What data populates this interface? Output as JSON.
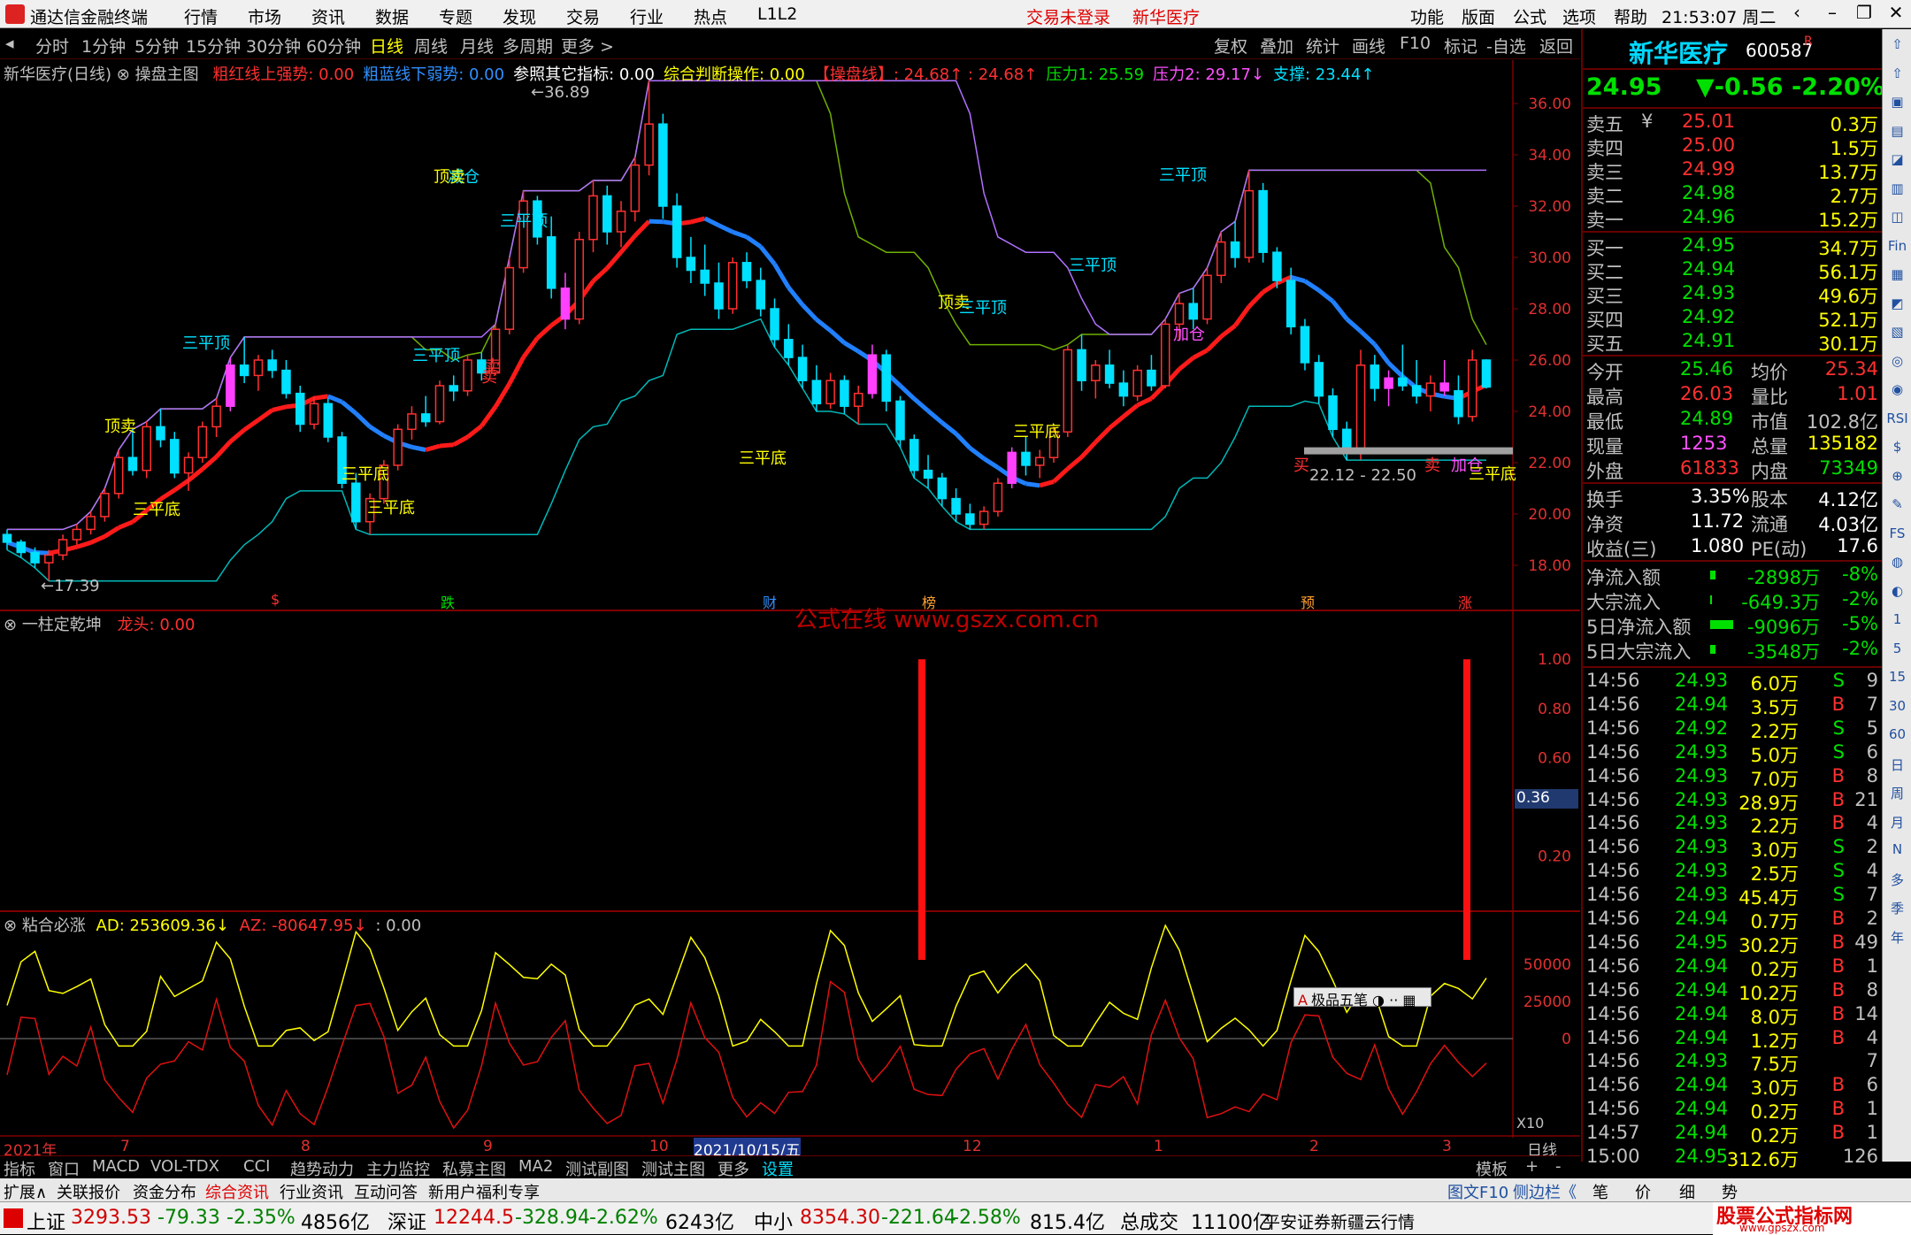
{
  "app": {
    "title": "通达信金融终端",
    "menu": [
      "行情",
      "市场",
      "资讯",
      "数据",
      "专题",
      "发现",
      "交易",
      "行业",
      "热点",
      "L1L2"
    ],
    "alert_login": "交易未登录",
    "alert_stock": "新华医疗",
    "right_menu": [
      "功能",
      "版面",
      "公式",
      "选项",
      "帮助"
    ],
    "clock": "21:53:07 周二"
  },
  "toolbar": {
    "periods": [
      "分时",
      "1分钟",
      "5分钟",
      "15分钟",
      "30分钟",
      "60分钟",
      "日线",
      "周线",
      "月线",
      "多周期",
      "更多 >"
    ],
    "selected": "日线",
    "right_items": [
      "复权",
      "叠加",
      "统计",
      "画线",
      "F10",
      "标记",
      "-自选",
      "返回"
    ]
  },
  "main_panel": {
    "stock_label": "新华医疗(日线)",
    "indicator_name": "操盘主图",
    "params": [
      {
        "label": "粗红线上强势: 0.00",
        "color": "#ff3030"
      },
      {
        "label": "粗蓝线下弱势: 0.00",
        "color": "#3090ff"
      },
      {
        "label": "参照其它指标: 0.00",
        "color": "#ffffff"
      },
      {
        "label": "综合判断操作: 0.00",
        "color": "#ffff00"
      },
      {
        "label": "【操盘线】: 24.68↑ : 24.68↑",
        "color": "#ff3030"
      },
      {
        "label": "压力1: 25.59",
        "color": "#00e000"
      },
      {
        "label": "压力2: 29.17↓",
        "color": "#ff50ff"
      },
      {
        "label": "支撑: 23.44↑",
        "color": "#00e0ff"
      }
    ],
    "y_ticks": [
      "36.00",
      "34.00",
      "32.00",
      "30.00",
      "28.00",
      "26.00",
      "24.00",
      "22.00",
      "20.00",
      "18.00"
    ],
    "high_label": "36.89",
    "low_label": "17.39",
    "range_label": "22.12 - 22.50",
    "annotations": [
      "顶卖",
      "三平顶",
      "减仓",
      "卖",
      "三平底",
      "顶卖",
      "三平顶",
      "卖",
      "三平底",
      "三平底",
      "三平顶",
      "顶卖",
      "三平顶",
      "三平底",
      "三平底",
      "三平顶",
      "三平顶",
      "加仓",
      "加仓",
      "三平底",
      "买",
      "卖"
    ],
    "event_markers": [
      "$",
      "跌",
      "财",
      "榜",
      "预",
      "涨"
    ],
    "watermark": "公式在线  www.gszx.com.cn"
  },
  "mid_panel": {
    "name": "一柱定乾坤",
    "param": "龙头: 0.00",
    "y_ticks": [
      "1.00",
      "0.80",
      "0.60",
      "0.36",
      "0.20"
    ],
    "current_value": "0.36"
  },
  "low_panel": {
    "name": "粘合必涨",
    "ad": "AD: 253609.36↓",
    "az": "AZ: -80647.95↓",
    "extra": ": 0.00",
    "y_ticks": [
      "50000",
      "25000",
      "0"
    ],
    "scale_label": "X10",
    "ime_label": "极品五笔"
  },
  "x_axis": {
    "labels": [
      "2021年",
      "7",
      "8",
      "9",
      "10",
      "2021/10/15/五",
      "12",
      "1",
      "2",
      "3"
    ],
    "period": "日线"
  },
  "quote": {
    "name": "新华医疗",
    "code": "600587",
    "flag": "R",
    "price": "24.95",
    "change": "▼-0.56",
    "pct": "-2.20%",
    "asks": [
      {
        "label": "卖五",
        "sym": "¥",
        "price": "25.01",
        "vol": "0.3万"
      },
      {
        "label": "卖四",
        "sym": "",
        "price": "25.00",
        "vol": "1.5万"
      },
      {
        "label": "卖三",
        "sym": "",
        "price": "24.99",
        "vol": "13.7万"
      },
      {
        "label": "卖二",
        "sym": "",
        "price": "24.98",
        "vol": "2.7万"
      },
      {
        "label": "卖一",
        "sym": "",
        "price": "24.96",
        "vol": "15.2万"
      }
    ],
    "bids": [
      {
        "label": "买一",
        "price": "24.95",
        "vol": "34.7万"
      },
      {
        "label": "买二",
        "price": "24.94",
        "vol": "56.1万"
      },
      {
        "label": "买三",
        "price": "24.93",
        "vol": "49.6万"
      },
      {
        "label": "买四",
        "price": "24.92",
        "vol": "52.1万"
      },
      {
        "label": "买五",
        "price": "24.91",
        "vol": "30.1万"
      }
    ],
    "stats": [
      [
        "今开",
        "25.46",
        "均价",
        "25.34"
      ],
      [
        "最高",
        "26.03",
        "量比",
        "1.01"
      ],
      [
        "最低",
        "24.89",
        "市值",
        "102.8亿"
      ],
      [
        "现量",
        "1253",
        "总量",
        "135182"
      ],
      [
        "外盘",
        "61833",
        "内盘",
        "73349"
      ]
    ],
    "stats2": [
      [
        "换手",
        "3.35%",
        "股本",
        "4.12亿"
      ],
      [
        "净资",
        "11.72",
        "流通",
        "4.03亿"
      ],
      [
        "收益(三)",
        "1.080",
        "PE(动)",
        "17.6"
      ]
    ],
    "flows": [
      {
        "label": "净流入额",
        "value": "-2898万",
        "pct": "-8%"
      },
      {
        "label": "大宗流入",
        "value": "-649.3万",
        "pct": "-2%"
      },
      {
        "label": "5日净流入额",
        "value": "-9096万",
        "pct": "-5%"
      },
      {
        "label": "5日大宗流入",
        "value": "-3548万",
        "pct": "-2%"
      }
    ],
    "ticks": [
      [
        "14:56",
        "24.93",
        "6.0万",
        "S",
        "9"
      ],
      [
        "14:56",
        "24.94",
        "3.5万",
        "B",
        "7"
      ],
      [
        "14:56",
        "24.92",
        "2.2万",
        "S",
        "5"
      ],
      [
        "14:56",
        "24.93",
        "5.0万",
        "S",
        "6"
      ],
      [
        "14:56",
        "24.93",
        "7.0万",
        "B",
        "8"
      ],
      [
        "14:56",
        "24.93",
        "28.9万",
        "B",
        "21"
      ],
      [
        "14:56",
        "24.93",
        "2.2万",
        "B",
        "4"
      ],
      [
        "14:56",
        "24.93",
        "3.0万",
        "S",
        "2"
      ],
      [
        "14:56",
        "24.93",
        "2.5万",
        "S",
        "4"
      ],
      [
        "14:56",
        "24.93",
        "45.4万",
        "S",
        "7"
      ],
      [
        "14:56",
        "24.94",
        "0.7万",
        "B",
        "2"
      ],
      [
        "14:56",
        "24.95",
        "30.2万",
        "B",
        "49"
      ],
      [
        "14:56",
        "24.94",
        "0.2万",
        "B",
        "1"
      ],
      [
        "14:56",
        "24.94",
        "10.2万",
        "B",
        "8"
      ],
      [
        "14:56",
        "24.94",
        "8.0万",
        "B",
        "14"
      ],
      [
        "14:56",
        "24.94",
        "1.2万",
        "B",
        "4"
      ],
      [
        "14:56",
        "24.93",
        "7.5万",
        "",
        "7"
      ],
      [
        "14:56",
        "24.94",
        "3.0万",
        "B",
        "6"
      ],
      [
        "14:56",
        "24.94",
        "0.2万",
        "B",
        "1"
      ],
      [
        "14:57",
        "24.94",
        "0.2万",
        "B",
        "1"
      ],
      [
        "15:00",
        "24.95",
        "312.6万",
        "",
        "126"
      ]
    ]
  },
  "sidebar_items": [
    "⇧",
    "⇧",
    "▣",
    "▤",
    "◪",
    "▥",
    "◫",
    "Fin",
    "▦",
    "◩",
    "▧",
    "◎",
    "◉",
    "RSI",
    "$",
    "⊕",
    "✎",
    "FS",
    "◍",
    "◐",
    "1",
    "5",
    "15",
    "30",
    "60",
    "日",
    "周",
    "月",
    "N",
    "多",
    "季",
    "年"
  ],
  "bottom_tabs": [
    "指标",
    "窗口",
    "MACD",
    "VOL-TDX",
    "CCI",
    "趋势动力",
    "主力监控",
    "私募主图",
    "MA2",
    "测试副图",
    "测试主图",
    "更多",
    "设置"
  ],
  "bottom_right": [
    "模板",
    "+",
    "-"
  ],
  "bottom_tabs2": [
    "扩展∧",
    "关联报价",
    "资金分布",
    "综合资讯",
    "行业资讯",
    "互动问答",
    "新用户福利专享"
  ],
  "bottom_tabs2_right": [
    "图文F10",
    "侧边栏《",
    "笔",
    "价",
    "细",
    "势"
  ],
  "status": {
    "sh_label": "上证",
    "sh_val": "3293.53",
    "sh_chg": "-79.33",
    "sh_pct": "-2.35%",
    "sh_amt": "4856亿",
    "sz_label": "深证",
    "sz_val": "12244.5",
    "sz_chg": "-328.94",
    "sz_pct": "-2.62%",
    "sz_amt": "6243亿",
    "zx_label": "中小",
    "zx_val": "8354.30",
    "zx_chg": "-221.64",
    "zx_pct": "-2.58%",
    "zx_amt": "815.4亿",
    "total_label": "总成交",
    "total_val": "11100亿",
    "broker": "平安证券新疆云行情",
    "logo_top": "股票公式指标网",
    "logo_bottom": "www.gpszx.com"
  },
  "chart_data": {
    "type": "candlestick",
    "price_range": [
      17,
      37
    ],
    "ohlc_approx": [
      [
        19.2,
        19.4,
        18.6,
        18.9
      ],
      [
        18.9,
        19.0,
        18.3,
        18.5
      ],
      [
        18.5,
        18.7,
        17.9,
        18.1
      ],
      [
        18.1,
        18.6,
        17.39,
        18.4
      ],
      [
        18.4,
        19.2,
        18.2,
        19.0
      ],
      [
        19.0,
        19.6,
        18.8,
        19.4
      ],
      [
        19.4,
        20.1,
        19.2,
        19.9
      ],
      [
        19.9,
        21.0,
        19.7,
        20.8
      ],
      [
        20.8,
        22.5,
        20.6,
        22.2
      ],
      [
        22.2,
        23.3,
        21.5,
        21.7
      ],
      [
        21.7,
        23.6,
        21.4,
        23.4
      ],
      [
        23.4,
        24.1,
        22.6,
        22.9
      ],
      [
        22.9,
        23.2,
        21.4,
        21.6
      ],
      [
        21.6,
        22.4,
        20.9,
        22.2
      ],
      [
        22.2,
        23.6,
        22.0,
        23.4
      ],
      [
        23.4,
        24.5,
        23.0,
        24.2
      ],
      [
        24.2,
        26.1,
        24.0,
        25.8
      ],
      [
        25.8,
        26.9,
        25.1,
        25.4
      ],
      [
        25.4,
        26.2,
        24.8,
        26.0
      ],
      [
        26.0,
        26.4,
        25.3,
        25.6
      ],
      [
        25.6,
        26.0,
        24.5,
        24.7
      ],
      [
        24.7,
        25.0,
        23.2,
        23.5
      ],
      [
        23.5,
        24.6,
        23.3,
        24.3
      ],
      [
        24.3,
        24.5,
        22.8,
        23.0
      ],
      [
        23.0,
        23.2,
        21.0,
        21.2
      ],
      [
        21.2,
        21.6,
        19.4,
        19.7
      ],
      [
        19.7,
        20.8,
        19.2,
        20.6
      ],
      [
        20.6,
        22.1,
        20.4,
        21.9
      ],
      [
        21.9,
        23.5,
        21.7,
        23.3
      ],
      [
        23.3,
        24.2,
        22.9,
        23.9
      ],
      [
        23.9,
        24.6,
        23.4,
        23.6
      ],
      [
        23.6,
        25.2,
        23.5,
        25.0
      ],
      [
        25.0,
        25.4,
        24.4,
        24.8
      ],
      [
        24.8,
        26.2,
        24.6,
        26.0
      ],
      [
        26.0,
        26.3,
        25.2,
        25.5
      ],
      [
        25.5,
        27.4,
        25.4,
        27.2
      ],
      [
        27.2,
        30.0,
        27.0,
        29.6
      ],
      [
        29.6,
        32.6,
        29.4,
        32.2
      ],
      [
        32.2,
        32.4,
        30.5,
        30.8
      ],
      [
        30.8,
        31.6,
        28.4,
        28.8
      ],
      [
        28.8,
        29.4,
        27.2,
        27.6
      ],
      [
        27.6,
        31.0,
        27.4,
        30.7
      ],
      [
        30.7,
        33.0,
        30.2,
        32.4
      ],
      [
        32.4,
        32.8,
        30.5,
        31.0
      ],
      [
        31.0,
        32.2,
        30.4,
        31.8
      ],
      [
        31.8,
        33.9,
        31.4,
        33.6
      ],
      [
        33.6,
        36.89,
        33.2,
        35.2
      ],
      [
        35.2,
        35.6,
        31.5,
        32.0
      ],
      [
        32.0,
        32.5,
        29.6,
        30.0
      ],
      [
        30.0,
        30.8,
        29.0,
        29.5
      ],
      [
        29.5,
        30.5,
        28.5,
        29.0
      ],
      [
        29.0,
        29.8,
        27.6,
        28.0
      ],
      [
        28.0,
        30.0,
        27.8,
        29.8
      ],
      [
        29.8,
        30.2,
        28.8,
        29.1
      ],
      [
        29.1,
        29.6,
        27.7,
        28.0
      ],
      [
        28.0,
        28.4,
        26.5,
        26.8
      ],
      [
        26.8,
        27.4,
        25.8,
        26.1
      ],
      [
        26.1,
        26.6,
        24.9,
        25.2
      ],
      [
        25.2,
        25.8,
        24.0,
        24.3
      ],
      [
        24.3,
        25.5,
        24.1,
        25.2
      ],
      [
        25.2,
        25.4,
        23.9,
        24.2
      ],
      [
        24.2,
        25.0,
        23.5,
        24.7
      ],
      [
        24.7,
        26.6,
        24.5,
        26.2
      ],
      [
        26.2,
        26.4,
        24.0,
        24.4
      ],
      [
        24.4,
        24.6,
        22.6,
        22.9
      ],
      [
        22.9,
        23.1,
        21.4,
        21.7
      ],
      [
        21.7,
        22.3,
        21.0,
        21.4
      ],
      [
        21.4,
        21.6,
        20.3,
        20.6
      ],
      [
        20.6,
        21.0,
        19.7,
        20.0
      ],
      [
        20.0,
        20.4,
        19.4,
        19.6
      ],
      [
        19.6,
        20.3,
        19.4,
        20.1
      ],
      [
        20.1,
        21.4,
        19.9,
        21.2
      ],
      [
        21.2,
        22.6,
        21.0,
        22.4
      ],
      [
        22.4,
        23.0,
        21.5,
        21.9
      ],
      [
        21.9,
        22.5,
        21.4,
        22.2
      ],
      [
        22.2,
        23.4,
        22.0,
        23.2
      ],
      [
        23.2,
        26.6,
        23.0,
        26.4
      ],
      [
        26.4,
        27.0,
        24.8,
        25.2
      ],
      [
        25.2,
        26.0,
        24.5,
        25.8
      ],
      [
        25.8,
        26.4,
        24.9,
        25.1
      ],
      [
        25.1,
        25.6,
        24.2,
        24.6
      ],
      [
        24.6,
        25.8,
        24.4,
        25.6
      ],
      [
        25.6,
        26.2,
        24.8,
        25.0
      ],
      [
        25.0,
        27.6,
        24.9,
        27.4
      ],
      [
        27.4,
        28.6,
        26.8,
        28.2
      ],
      [
        28.2,
        28.8,
        27.2,
        27.6
      ],
      [
        27.6,
        29.6,
        27.4,
        29.3
      ],
      [
        29.3,
        31.0,
        29.0,
        30.6
      ],
      [
        30.6,
        31.4,
        29.6,
        30.0
      ],
      [
        30.0,
        33.4,
        29.8,
        32.6
      ],
      [
        32.6,
        32.9,
        29.8,
        30.2
      ],
      [
        30.2,
        30.4,
        28.8,
        29.1
      ],
      [
        29.1,
        29.6,
        27.0,
        27.3
      ],
      [
        27.3,
        27.6,
        25.6,
        25.9
      ],
      [
        25.9,
        26.2,
        24.3,
        24.6
      ],
      [
        24.6,
        24.9,
        23.0,
        23.3
      ],
      [
        23.3,
        23.6,
        22.1,
        22.4
      ],
      [
        22.4,
        26.4,
        22.12,
        25.8
      ],
      [
        25.8,
        26.2,
        24.4,
        24.9
      ],
      [
        24.9,
        25.6,
        24.2,
        25.3
      ],
      [
        25.3,
        26.6,
        24.8,
        25.0
      ],
      [
        25.0,
        26.0,
        24.3,
        24.6
      ],
      [
        24.6,
        25.4,
        24.0,
        25.1
      ],
      [
        25.1,
        26.0,
        24.6,
        24.8
      ],
      [
        24.8,
        25.4,
        23.5,
        23.8
      ],
      [
        23.8,
        26.4,
        23.6,
        26.0
      ],
      [
        26.0,
        26.03,
        24.89,
        24.95
      ]
    ],
    "series": [
      {
        "name": "操盘线",
        "color": "#ff2020"
      },
      {
        "name": "压力1",
        "color": "#80c000"
      },
      {
        "name": "压力2",
        "color": "#c080ff"
      },
      {
        "name": "支撑",
        "color": "#00c0c0"
      }
    ]
  }
}
